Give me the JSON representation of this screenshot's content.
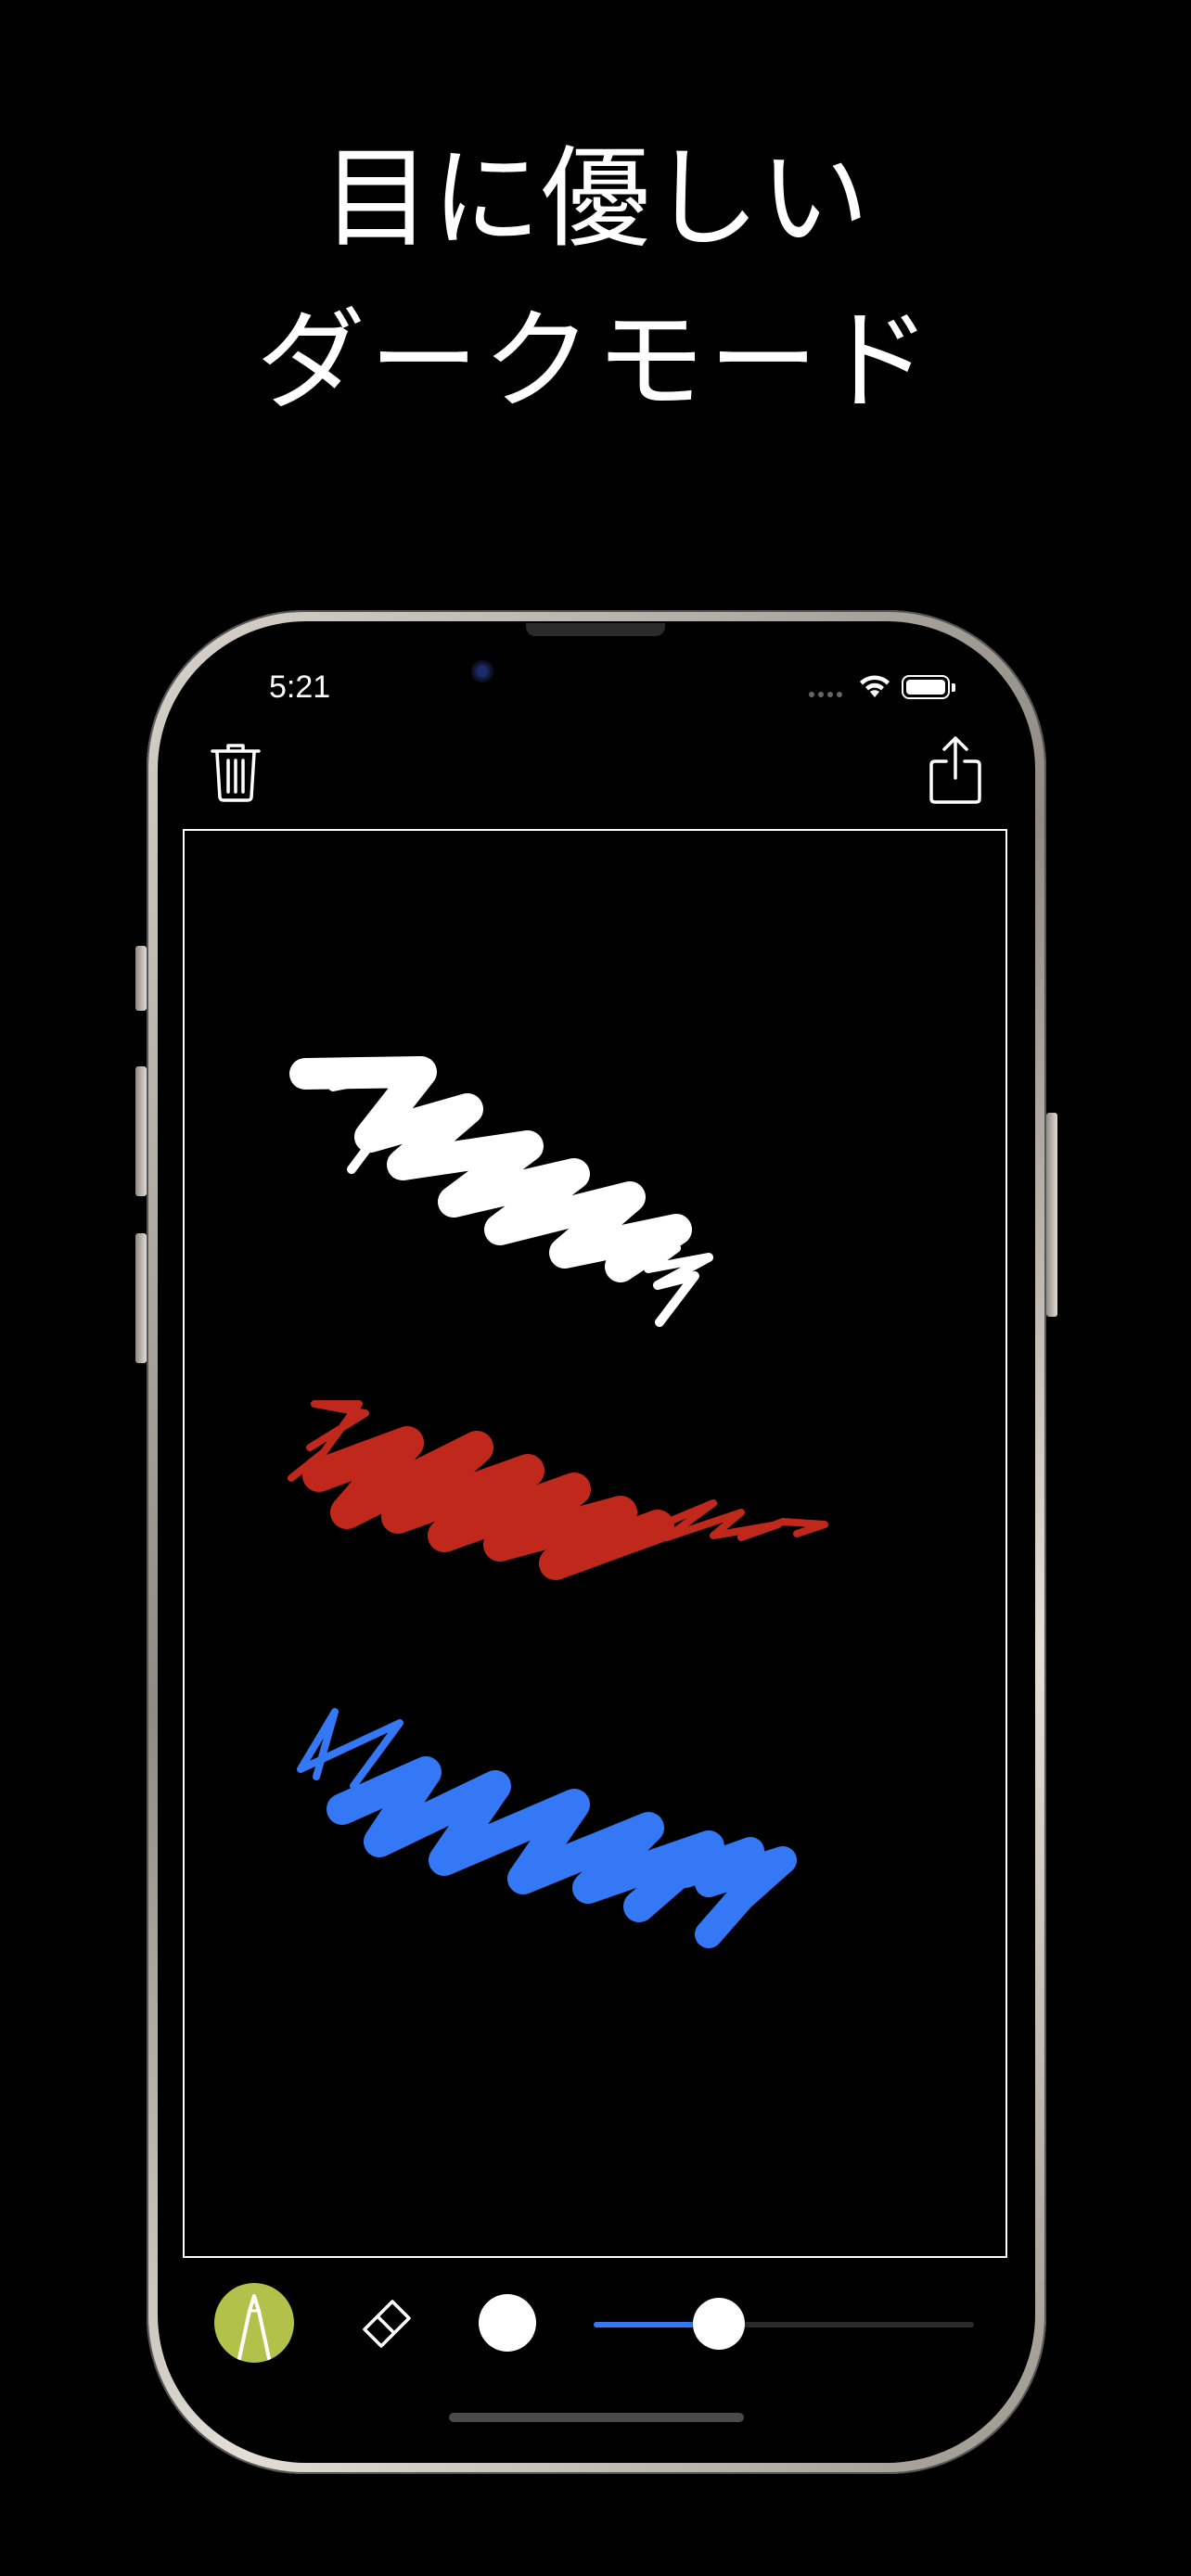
{
  "headline": {
    "line1": "目に優しい",
    "line2": "ダークモード"
  },
  "status_bar": {
    "time": "5:21"
  },
  "toolbar": {
    "delete_icon": "trash-icon",
    "share_icon": "share-icon"
  },
  "tools": {
    "pen_icon": "pen-icon",
    "eraser_icon": "eraser-icon",
    "selected_color": "#ffffff",
    "pen_color": "#b1c14a"
  },
  "brush_size": {
    "fraction": 0.33,
    "fill_color": "#3478f6"
  },
  "strokes": [
    {
      "name": "white-scribble",
      "color": "#ffffff"
    },
    {
      "name": "red-scribble",
      "color": "#c0281c"
    },
    {
      "name": "blue-scribble",
      "color": "#3478f6"
    }
  ]
}
